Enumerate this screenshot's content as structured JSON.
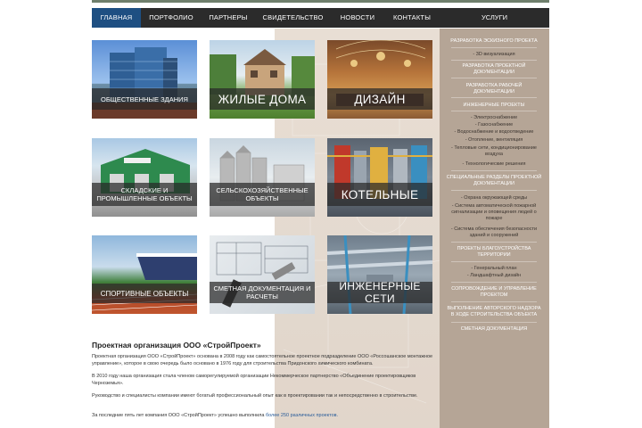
{
  "nav": {
    "items": [
      {
        "label": "ГЛАВНАЯ",
        "active": true
      },
      {
        "label": "ПОРТФОЛИО",
        "active": false
      },
      {
        "label": "ПАРТНЕРЫ",
        "active": false
      },
      {
        "label": "СВИДЕТЕЛЬСТВО",
        "active": false
      },
      {
        "label": "НОВОСТИ",
        "active": false
      },
      {
        "label": "КОНТАКТЫ",
        "active": false
      }
    ],
    "services_label": "УСЛУГИ"
  },
  "tiles": [
    {
      "caption": "ОБЩЕСТВЕННЫЕ ЗДАНИЯ",
      "style": "small"
    },
    {
      "caption": "ЖИЛЫЕ ДОМА",
      "style": "big"
    },
    {
      "caption": "ДИЗАЙН",
      "style": "big"
    },
    {
      "caption": "СКЛАДСКИЕ И ПРОМЫШЛЕННЫЕ ОБЪЕКТЫ",
      "style": "small"
    },
    {
      "caption": "СЕЛЬСКОХОЗЯЙСТВЕННЫЕ ОБЪЕКТЫ",
      "style": "small"
    },
    {
      "caption": "КОТЕЛЬНЫЕ",
      "style": "big"
    },
    {
      "caption": "СПОРТИВНЫЕ ОБЪЕКТЫ",
      "style": "small"
    },
    {
      "caption": "СМЕТНАЯ ДОКУМЕНТАЦИЯ И РАСЧЕТЫ",
      "style": "small"
    },
    {
      "caption": "ИНЖЕНЕРНЫЕ СЕТИ",
      "style": "big"
    }
  ],
  "services": [
    {
      "text": "РАЗРАБОТКА ЭСКИЗНОГО ПРОЕКТА",
      "kind": "head"
    },
    {
      "text": "- 3D визуализация",
      "kind": "sub"
    },
    {
      "text": "РАЗРАБОТКА ПРОЕКТНОЙ ДОКУМЕНТАЦИИ",
      "kind": "head"
    },
    {
      "text": "РАЗРАБОТКА РАБОЧЕЙ ДОКУМЕНТАЦИИ",
      "kind": "head"
    },
    {
      "text": "ИНЖЕНЕРНЫЕ ПРОЕКТЫ",
      "kind": "head"
    },
    {
      "text": "- Электроснабжение",
      "kind": "sub"
    },
    {
      "text": "- Газоснабжение",
      "kind": "sub"
    },
    {
      "text": "- Водоснабжение и водоотведение",
      "kind": "sub"
    },
    {
      "text": "- Отопление, вентиляция",
      "kind": "sub"
    },
    {
      "text": "- Тепловые сети, кондиционирование воздуха",
      "kind": "sub"
    },
    {
      "text": "- Технологические решения",
      "kind": "sub"
    },
    {
      "text": "СПЕЦИАЛЬНЫЕ РАЗДЕЛЫ ПРОЕКТНОЙ ДОКУМЕНТАЦИИ",
      "kind": "head"
    },
    {
      "text": "- Охрана окружающей среды",
      "kind": "sub"
    },
    {
      "text": "- Система автоматической пожарной сигнализации и оповещения людей о пожаре",
      "kind": "sub"
    },
    {
      "text": "- Система обеспечения безопасности зданий и сооружений",
      "kind": "sub"
    },
    {
      "text": "ПРОЕКТЫ БЛАГОУСТРОЙСТВА ТЕРРИТОРИИ",
      "kind": "head"
    },
    {
      "text": "- Генеральный план",
      "kind": "sub"
    },
    {
      "text": "- Ландшафтный дизайн",
      "kind": "sub"
    },
    {
      "text": "СОПРОВОЖДЕНИЕ И УПРАВЛЕНИЕ ПРОЕКТОМ",
      "kind": "head"
    },
    {
      "text": "ВЫПОЛНЕНИЕ АВТОРСКОГО НАДЗОРА В ХОДЕ СТРОИТЕЛЬСТВА ОБЪЕКТА",
      "kind": "head"
    },
    {
      "text": "СМЕТНАЯ ДОКУМЕНТАЦИЯ",
      "kind": "head"
    }
  ],
  "content": {
    "title": "Проектная организация ООО «СтройПроект»",
    "p1": "Проектная организация ООО «СтройПроект» основана в 2008 году как самостоятельное проектное подразделение ООО «Россошанское монтажное управление», которое в свою очередь было основано в 1976 году для строительства Придонского химического комбината.",
    "p2": "В 2010 году наша организация стала членом саморегулируемой организации Некоммерческое партнерство «Объединение проектировщиков Черноземья».",
    "p3": "Руководство и специалисты компании имеют богатый профессиональный опыт как в проектировании так и непосредственно в строительстве.",
    "p4_prefix": "За последние пять лет компания ООО «СтройПроект» успешно выполнила",
    "p4_link": "более 250 различных проектов."
  }
}
